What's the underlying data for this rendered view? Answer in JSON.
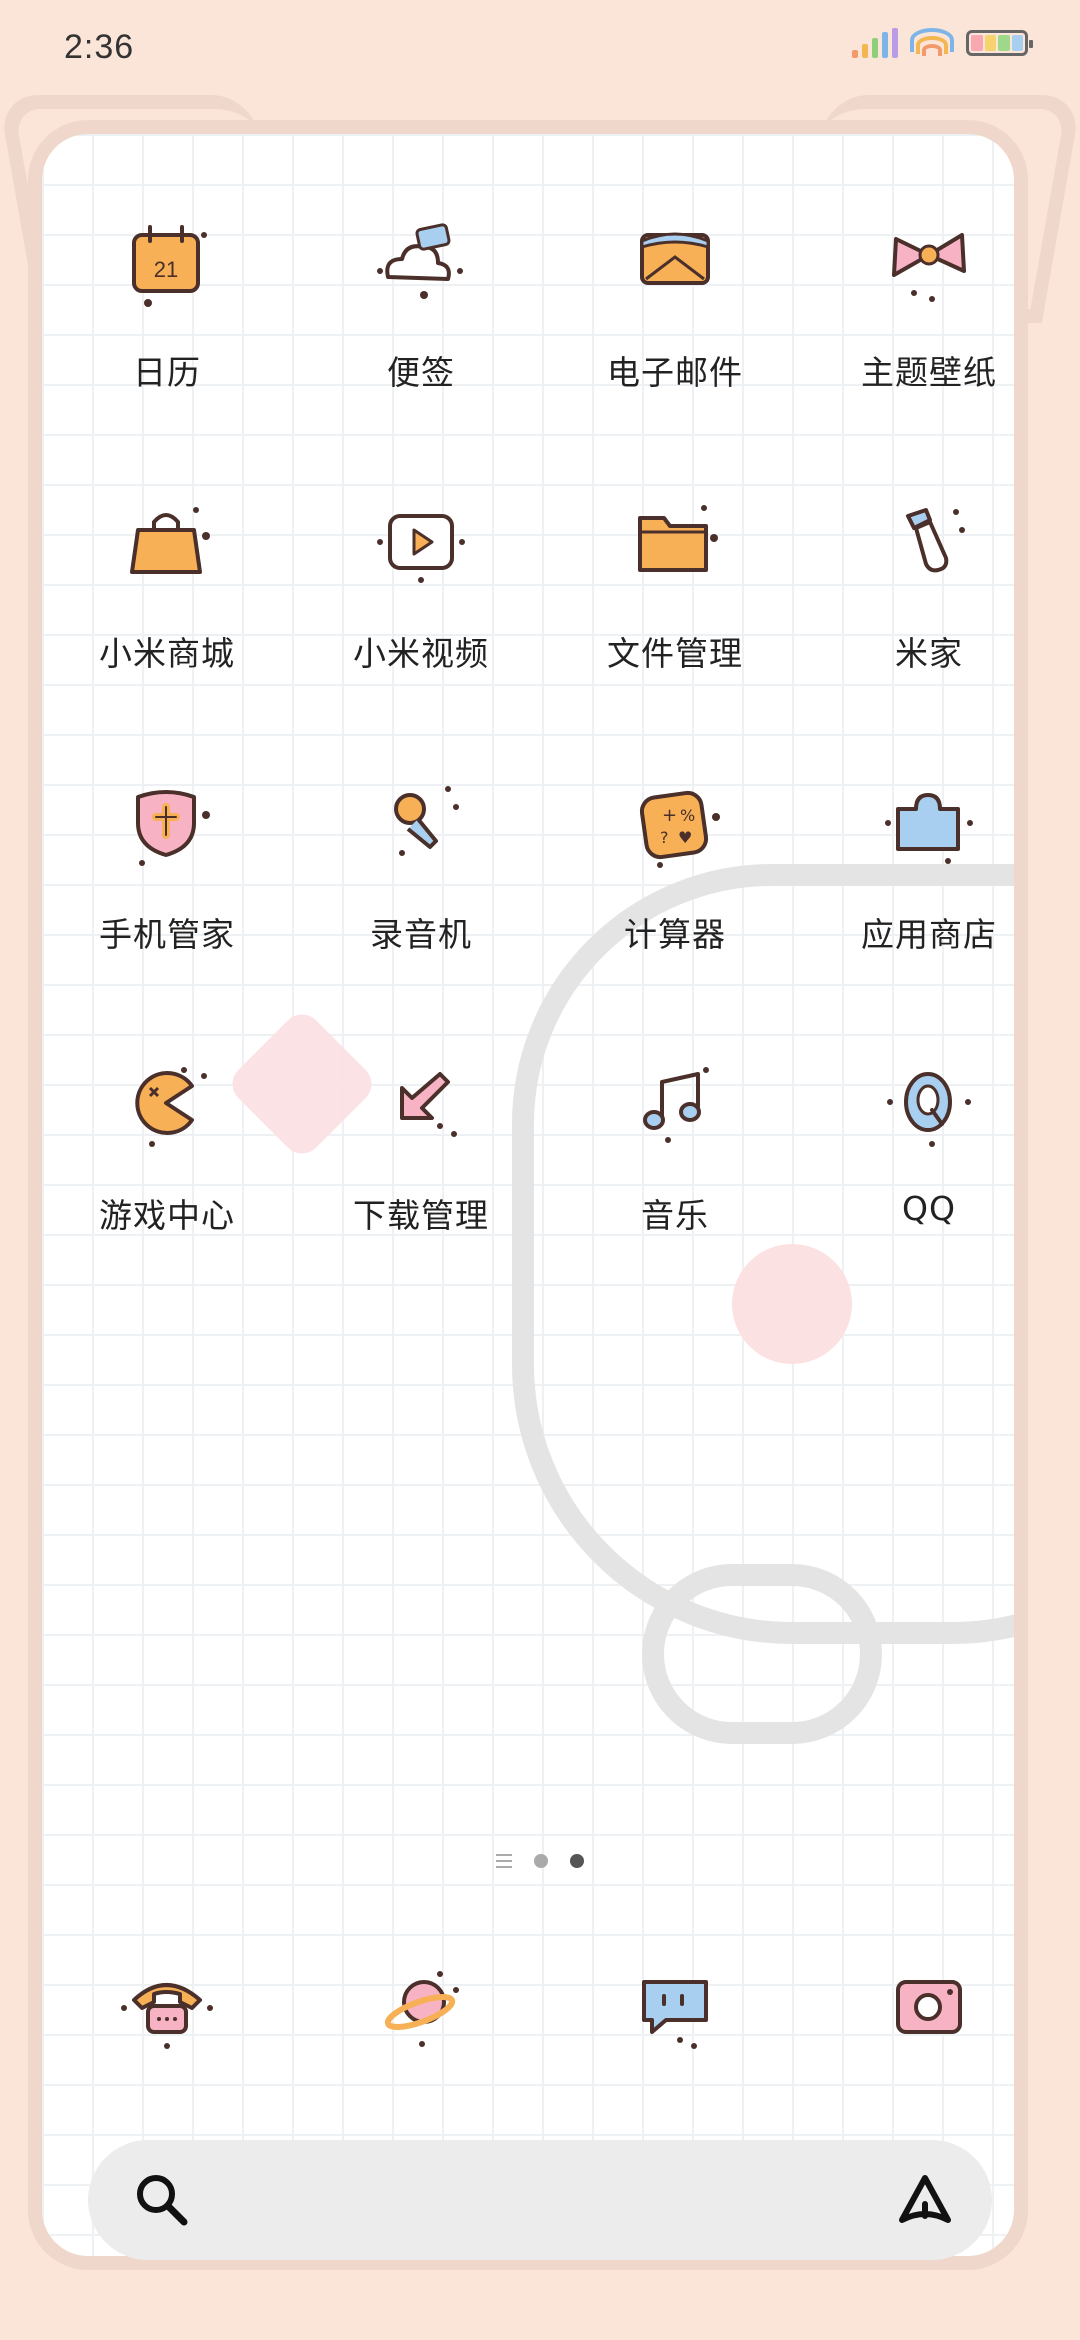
{
  "status_bar": {
    "time": "2:36",
    "icons": [
      "signal-icon",
      "wifi-icon",
      "battery-icon"
    ]
  },
  "apps": [
    {
      "label": "日历",
      "icon": "calendar-icon",
      "calendar_day": "21"
    },
    {
      "label": "便签",
      "icon": "notes-icon"
    },
    {
      "label": "电子邮件",
      "icon": "email-icon"
    },
    {
      "label": "主题壁纸",
      "icon": "themes-bow-icon"
    },
    {
      "label": "小米商城",
      "icon": "shopping-bag-icon"
    },
    {
      "label": "小米视频",
      "icon": "video-play-icon"
    },
    {
      "label": "文件管理",
      "icon": "folder-icon"
    },
    {
      "label": "米家",
      "icon": "mijia-bottle-icon"
    },
    {
      "label": "手机管家",
      "icon": "security-shield-icon"
    },
    {
      "label": "录音机",
      "icon": "microphone-icon"
    },
    {
      "label": "计算器",
      "icon": "calculator-icon"
    },
    {
      "label": "应用商店",
      "icon": "app-store-icon"
    },
    {
      "label": "游戏中心",
      "icon": "game-pacman-icon"
    },
    {
      "label": "下载管理",
      "icon": "download-arrow-icon"
    },
    {
      "label": "音乐",
      "icon": "music-note-icon"
    },
    {
      "label": "QQ",
      "icon": "qq-icon"
    }
  ],
  "page_indicator": {
    "pages": 3,
    "active_index": 2
  },
  "dock": [
    {
      "icon": "phone-icon"
    },
    {
      "icon": "browser-planet-icon"
    },
    {
      "icon": "messages-icon"
    },
    {
      "icon": "camera-icon"
    }
  ],
  "search_bar": {
    "icons": [
      "search-icon",
      "assistant-icon"
    ]
  },
  "colors": {
    "background": "#fbe5d8",
    "orange": "#f7b055",
    "pink": "#f7b3c4",
    "blue": "#a8cff0",
    "outline": "#4a2f2a"
  }
}
